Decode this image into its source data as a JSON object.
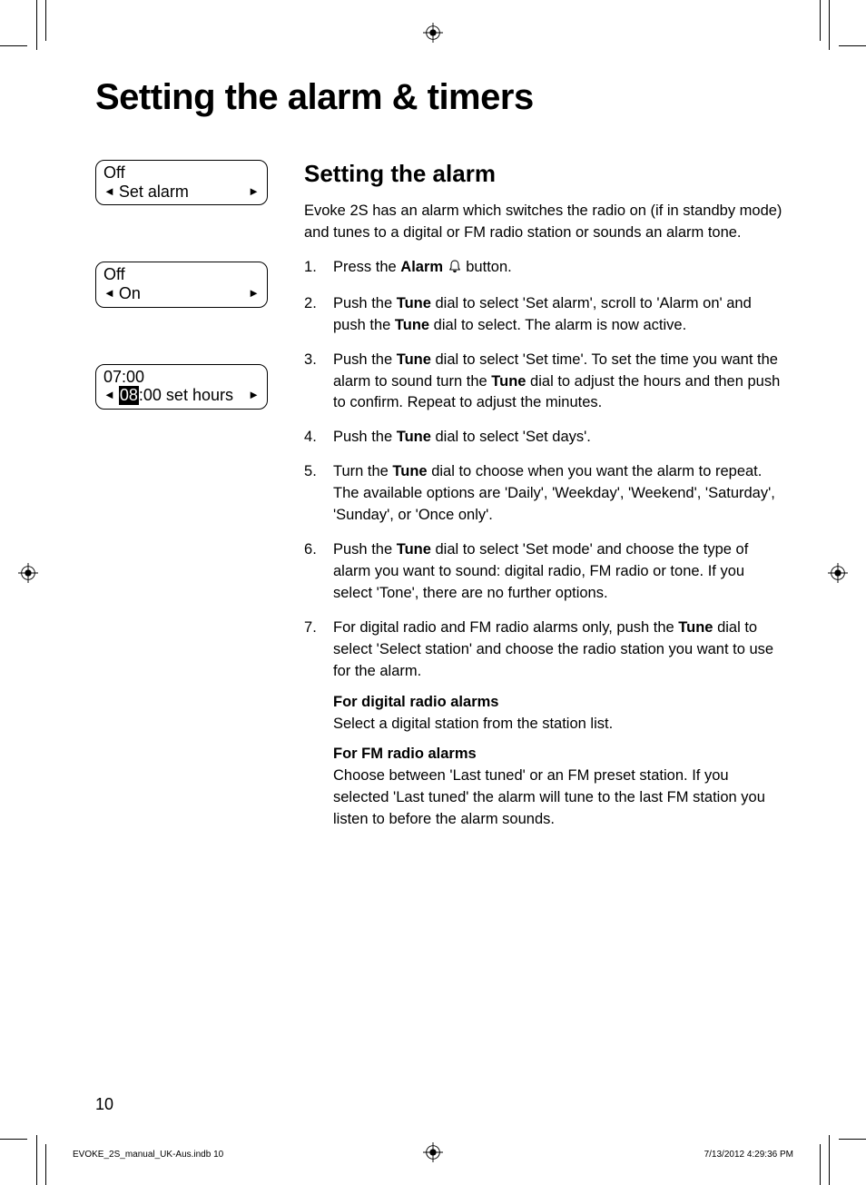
{
  "title": "Setting the alarm & timers",
  "lcd": {
    "box1": {
      "line1": "Off",
      "line2": "Set alarm"
    },
    "box2": {
      "line1": "Off",
      "line2": "On"
    },
    "box3": {
      "line1": "07:00",
      "highlight": "08",
      "rest": ":00 set hours"
    }
  },
  "subtitle": "Setting the alarm",
  "intro": "Evoke 2S has an alarm which switches the radio on (if in standby mode) and tunes to a digital or FM radio station or sounds an alarm tone.",
  "steps": {
    "s1a": "Press the ",
    "s1b": "Alarm",
    "s1c": " button.",
    "s2a": "Push the ",
    "s2b": "Tune",
    "s2c": " dial to select 'Set alarm', scroll to 'Alarm on' and push the ",
    "s2d": "Tune",
    "s2e": " dial to select. The alarm is now active.",
    "s3a": "Push the ",
    "s3b": "Tune",
    "s3c": " dial to select 'Set time'. To set the time you want the alarm to sound turn the ",
    "s3d": "Tune",
    "s3e": " dial to adjust the hours and then push to confirm. Repeat to adjust the minutes.",
    "s4a": "Push the ",
    "s4b": "Tune",
    "s4c": " dial to select 'Set days'.",
    "s5a": "Turn the ",
    "s5b": "Tune",
    "s5c": " dial to choose when you want the alarm to repeat. The available options are 'Daily', 'Weekday', 'Weekend', 'Saturday', 'Sunday', or 'Once only'.",
    "s6a": "Push the ",
    "s6b": "Tune",
    "s6c": " dial to select 'Set mode' and choose the type of alarm you want to sound: digital radio, FM radio or tone. If you select 'Tone', there are no further options.",
    "s7a": "For digital radio and FM radio alarms only, push the ",
    "s7b": "Tune",
    "s7c": " dial to select 'Select station' and choose the radio station you want to use for the alarm.",
    "s7_dig_h": "For digital radio alarms",
    "s7_dig_p": "Select a digital station from the station list.",
    "s7_fm_h": "For FM radio alarms",
    "s7_fm_p": "Choose between 'Last tuned' or an FM preset station. If you selected 'Last tuned' the alarm will tune to the last FM station you listen to before the alarm sounds."
  },
  "page_number": "10",
  "footer_left": "EVOKE_2S_manual_UK-Aus.indb   10",
  "footer_right": "7/13/2012   4:29:36 PM"
}
